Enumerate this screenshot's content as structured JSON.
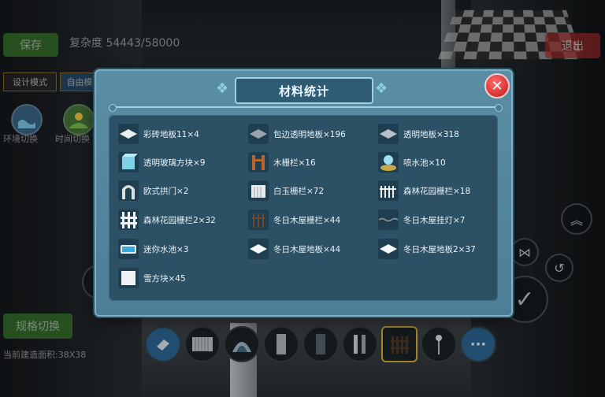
{
  "hud": {
    "save_label": "保存",
    "complexity_label": "复杂度 54443/58000",
    "exit_label": "退出",
    "design_mode_label": "设计模式",
    "free_mode_label": "自由模",
    "env_switch_label": "环境切换",
    "time_switch_label": "时间切换",
    "spec_switch_label": "规格切换",
    "build_area_label": "当前建造面积:38X38"
  },
  "modal": {
    "title": "材料统计",
    "close_label": "✕",
    "items": [
      {
        "label": "彩砖地板11×4",
        "icon": "tile-floor-icon"
      },
      {
        "label": "包边透明地板×196",
        "icon": "edged-glass-floor-icon"
      },
      {
        "label": "透明地板×318",
        "icon": "glass-floor-icon"
      },
      {
        "label": "透明玻璃方块×9",
        "icon": "glass-block-icon"
      },
      {
        "label": "木栅栏×16",
        "icon": "wood-fence-icon"
      },
      {
        "label": "喷水池×10",
        "icon": "fountain-icon"
      },
      {
        "label": "欧式拱门×2",
        "icon": "arch-door-icon"
      },
      {
        "label": "白玉栅栏×72",
        "icon": "jade-fence-icon"
      },
      {
        "label": "森林花园栅栏×18",
        "icon": "garden-fence-icon"
      },
      {
        "label": "森林花园栅栏2×32",
        "icon": "garden-fence-2-icon"
      },
      {
        "label": "冬日木屋栅栏×44",
        "icon": "winter-fence-icon"
      },
      {
        "label": "冬日木屋挂灯×7",
        "icon": "winter-lamp-icon"
      },
      {
        "label": "迷你水池×3",
        "icon": "mini-pool-icon"
      },
      {
        "label": "冬日木屋地板×44",
        "icon": "winter-floor-icon"
      },
      {
        "label": "冬日木屋地板2×37",
        "icon": "winter-floor-2-icon"
      },
      {
        "label": "雪方块×45",
        "icon": "snow-block-icon"
      }
    ]
  },
  "toolbar": {
    "more_label": "···",
    "tools": [
      "eraser-icon",
      "wall-panel-icon",
      "dome-icon",
      "pillar-icon",
      "pillar-dark-icon",
      "door-icon",
      "fence-icon",
      "lamp-post-icon",
      "more-icon"
    ]
  }
}
